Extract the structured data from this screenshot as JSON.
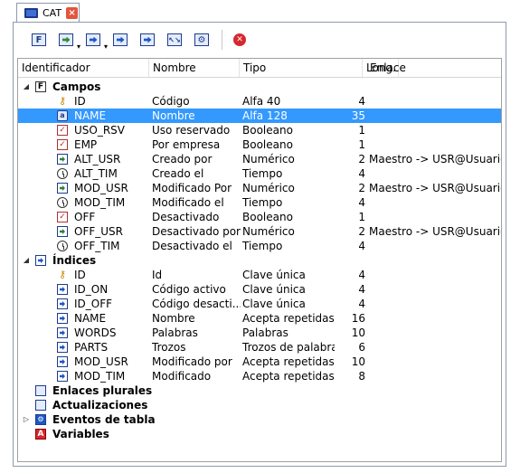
{
  "tab": {
    "label": "CAT",
    "close": "×"
  },
  "toolbar": {
    "buttons": [
      {
        "icon": "field-icon",
        "glyph": "F"
      },
      {
        "icon": "insert-icon"
      },
      {
        "icon": "insert-after-icon"
      },
      {
        "icon": "index-icon"
      },
      {
        "icon": "index-arrow-icon"
      },
      {
        "icon": "link-icon"
      },
      {
        "icon": "gear-icon"
      }
    ],
    "stop": "✕"
  },
  "columns": {
    "id": "Identificador",
    "name": "Nombre",
    "type": "Tipo",
    "len": "Long.",
    "link": "Enlace"
  },
  "groups": {
    "fields": {
      "label": "Campos",
      "expander": "◢"
    },
    "indices": {
      "label": "Índices",
      "expander": "◢"
    },
    "plural_links": {
      "label": "Enlaces plurales"
    },
    "updates": {
      "label": "Actualizaciones"
    },
    "events": {
      "label": "Eventos de tabla",
      "expander": "▷"
    },
    "variables": {
      "label": "Variables",
      "glyph": "A"
    }
  },
  "fields": [
    {
      "id": "ID",
      "name": "Código",
      "type": "Alfa 40",
      "len": "4",
      "link": "",
      "icon": "key-icon"
    },
    {
      "id": "NAME",
      "name": "Nombre",
      "type": "Alfa 128",
      "len": "35",
      "link": "",
      "icon": "text-icon",
      "selected": true
    },
    {
      "id": "USO_RSV",
      "name": "Uso reservado",
      "type": "Booleano",
      "len": "1",
      "link": "",
      "icon": "check-icon"
    },
    {
      "id": "EMP",
      "name": "Por empresa",
      "type": "Booleano",
      "len": "1",
      "link": "",
      "icon": "check-icon"
    },
    {
      "id": "ALT_USR",
      "name": "Creado por",
      "type": "Numérico",
      "len": "2",
      "link": "Maestro -> USR@Usuarios",
      "icon": "number-icon"
    },
    {
      "id": "ALT_TIM",
      "name": "Creado el",
      "type": "Tiempo",
      "len": "4",
      "link": "",
      "icon": "clock-icon"
    },
    {
      "id": "MOD_USR",
      "name": "Modificado Por",
      "type": "Numérico",
      "len": "2",
      "link": "Maestro -> USR@Usuarios",
      "icon": "number-icon"
    },
    {
      "id": "MOD_TIM",
      "name": "Modificado el",
      "type": "Tiempo",
      "len": "4",
      "link": "",
      "icon": "clock-icon"
    },
    {
      "id": "OFF",
      "name": "Desactivado",
      "type": "Booleano",
      "len": "1",
      "link": "",
      "icon": "check-icon"
    },
    {
      "id": "OFF_USR",
      "name": "Desactivado por",
      "type": "Numérico",
      "len": "2",
      "link": "Maestro -> USR@Usuarios",
      "icon": "number-icon"
    },
    {
      "id": "OFF_TIM",
      "name": "Desactivado el",
      "type": "Tiempo",
      "len": "4",
      "link": "",
      "icon": "clock-icon"
    }
  ],
  "indices": [
    {
      "id": "ID",
      "name": "Id",
      "type": "Clave única",
      "len": "4",
      "icon": "key-icon"
    },
    {
      "id": "ID_ON",
      "name": "Código activo",
      "type": "Clave única",
      "len": "4",
      "icon": "index-icon"
    },
    {
      "id": "ID_OFF",
      "name": "Código desacti...",
      "type": "Clave única",
      "len": "4",
      "icon": "index-icon"
    },
    {
      "id": "NAME",
      "name": "Nombre",
      "type": "Acepta repetidas",
      "len": "16",
      "icon": "index-icon"
    },
    {
      "id": "WORDS",
      "name": "Palabras",
      "type": "Palabras",
      "len": "10",
      "icon": "index-icon"
    },
    {
      "id": "PARTS",
      "name": "Trozos",
      "type": "Trozos de palabras",
      "len": "6",
      "icon": "index-icon"
    },
    {
      "id": "MOD_USR",
      "name": "Modificado por",
      "type": "Acepta repetidas",
      "len": "10",
      "icon": "index-icon"
    },
    {
      "id": "MOD_TIM",
      "name": "Modificado",
      "type": "Acepta repetidas",
      "len": "8",
      "icon": "index-icon"
    }
  ]
}
